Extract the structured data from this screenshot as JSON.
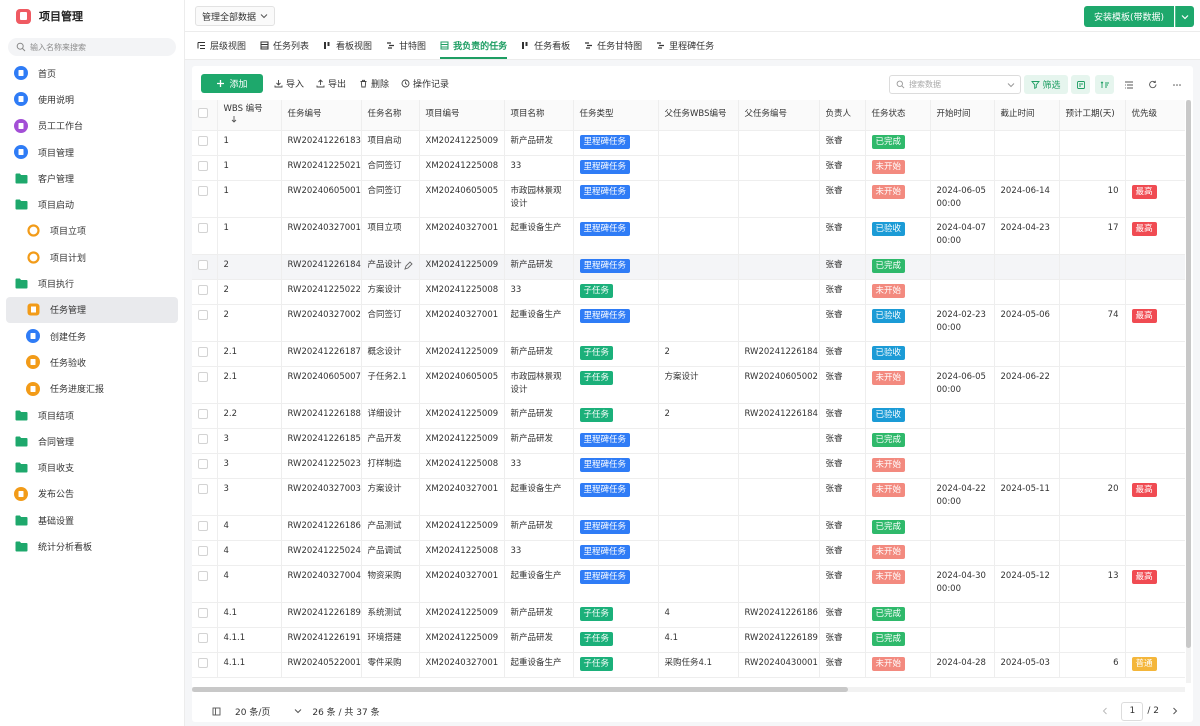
{
  "app": {
    "title": "项目管理"
  },
  "sidebar": {
    "search_placeholder": "输入名称来搜索",
    "items": [
      {
        "label": "首页",
        "icon": "home-icon",
        "type": "circle",
        "color": "#2f7cf6"
      },
      {
        "label": "使用说明",
        "icon": "doc-icon",
        "type": "circle",
        "color": "#2f7cf6"
      },
      {
        "label": "员工工作台",
        "icon": "user-icon",
        "type": "circle",
        "color": "#a34fd6"
      },
      {
        "label": "项目管理",
        "icon": "doc-icon",
        "type": "circle",
        "color": "#2f7cf6"
      },
      {
        "label": "客户管理",
        "icon": "folder-icon",
        "type": "folder",
        "color": "#1ea86c"
      },
      {
        "label": "项目启动",
        "icon": "folder-icon",
        "type": "folder",
        "color": "#1ea86c"
      },
      {
        "label": "项目立项",
        "icon": "circle-o-icon",
        "type": "ring",
        "color": "#f29b18",
        "sub": true
      },
      {
        "label": "项目计划",
        "icon": "circle-o-icon",
        "type": "ring",
        "color": "#f29b18",
        "sub": true
      },
      {
        "label": "项目执行",
        "icon": "folder-icon",
        "type": "folder",
        "color": "#1ea86c"
      },
      {
        "label": "任务管理",
        "icon": "task-icon",
        "type": "square",
        "color": "#f29b18",
        "sub": true,
        "active": true
      },
      {
        "label": "创建任务",
        "icon": "send-icon",
        "type": "circle",
        "color": "#2f7cf6",
        "sub": true
      },
      {
        "label": "任务验收",
        "icon": "shield-icon",
        "type": "circle",
        "color": "#f29b18",
        "sub": true
      },
      {
        "label": "任务进度汇报",
        "icon": "shield-icon",
        "type": "circle",
        "color": "#f29b18",
        "sub": true
      },
      {
        "label": "项目结项",
        "icon": "folder-icon",
        "type": "folder",
        "color": "#1ea86c"
      },
      {
        "label": "合同管理",
        "icon": "folder-icon",
        "type": "folder",
        "color": "#1ea86c"
      },
      {
        "label": "项目收支",
        "icon": "folder-icon",
        "type": "folder",
        "color": "#1ea86c"
      },
      {
        "label": "发布公告",
        "icon": "announce-icon",
        "type": "circle",
        "color": "#f29b18"
      },
      {
        "label": "基础设置",
        "icon": "folder-icon",
        "type": "folder",
        "color": "#1ea86c"
      },
      {
        "label": "统计分析看板",
        "icon": "folder-icon",
        "type": "folder",
        "color": "#1ea86c"
      }
    ]
  },
  "topbar": {
    "scope": "管理全部数据",
    "install_label": "安装模板(带数据)"
  },
  "tabs": [
    {
      "label": "层级视图",
      "icon": "hierarchy-icon"
    },
    {
      "label": "任务列表",
      "icon": "table-icon"
    },
    {
      "label": "看板视图",
      "icon": "kanban-icon"
    },
    {
      "label": "甘特图",
      "icon": "gantt-icon"
    },
    {
      "label": "我负责的任务",
      "icon": "table-icon",
      "active": true
    },
    {
      "label": "任务看板",
      "icon": "kanban-icon"
    },
    {
      "label": "任务甘特图",
      "icon": "gantt-icon"
    },
    {
      "label": "里程碑任务",
      "icon": "gantt-icon"
    }
  ],
  "toolbar": {
    "add": "添加",
    "import": "导入",
    "export": "导出",
    "delete": "删除",
    "log": "操作记录",
    "search_placeholder": "搜索数据",
    "filter": "筛选"
  },
  "colors": {
    "green": "#1ea86c",
    "tag_milestone": "#2f7cf6",
    "tag_subtask": "#1bb07a",
    "status_done": "#2fb96b",
    "status_notstarted": "#f38a7f",
    "status_accepted": "#1b9bd6",
    "pri_high": "#f04b52",
    "pri_normal": "#f4b63a"
  },
  "table": {
    "columns": [
      "WBS 编号",
      "任务编号",
      "任务名称",
      "项目编号",
      "项目名称",
      "任务类型",
      "父任务WBS编号",
      "父任务编号",
      "负责人",
      "任务状态",
      "开始时间",
      "截止时间",
      "预计工期(天)",
      "优先级"
    ],
    "rows": [
      {
        "wbs": "1",
        "task_no": "RW20241226183",
        "task_name": "项目启动",
        "proj_no": "XM20241225009",
        "proj_name": "新产品研发",
        "type": "里程碑任务",
        "parent_wbs": "",
        "parent_no": "",
        "owner": "张睿",
        "status": "已完成",
        "start": "",
        "end": "",
        "dur": "",
        "priority": ""
      },
      {
        "wbs": "1",
        "task_no": "RW20241225021",
        "task_name": "合同签订",
        "proj_no": "XM20241225008",
        "proj_name": "33",
        "type": "里程碑任务",
        "parent_wbs": "",
        "parent_no": "",
        "owner": "张睿",
        "status": "未开始",
        "start": "",
        "end": "",
        "dur": "",
        "priority": ""
      },
      {
        "wbs": "1",
        "task_no": "RW20240605001",
        "task_name": "合同签订",
        "proj_no": "XM20240605005",
        "proj_name": "市政园林景观设计",
        "type": "里程碑任务",
        "parent_wbs": "",
        "parent_no": "",
        "owner": "张睿",
        "status": "未开始",
        "start": "2024-06-05 00:00",
        "end": "2024-06-14",
        "dur": "10",
        "priority": "最高"
      },
      {
        "wbs": "1",
        "task_no": "RW20240327001",
        "task_name": "项目立项",
        "proj_no": "XM20240327001",
        "proj_name": "起重设备生产",
        "type": "里程碑任务",
        "parent_wbs": "",
        "parent_no": "",
        "owner": "张睿",
        "status": "已验收",
        "start": "2024-04-07 00:00",
        "end": "2024-04-23",
        "dur": "17",
        "priority": "最高"
      },
      {
        "wbs": "2",
        "task_no": "RW20241226184",
        "task_name": "产品设计",
        "proj_no": "XM20241225009",
        "proj_name": "新产品研发",
        "type": "里程碑任务",
        "parent_wbs": "",
        "parent_no": "",
        "owner": "张睿",
        "status": "已完成",
        "start": "",
        "end": "",
        "dur": "",
        "priority": "",
        "highlight": true
      },
      {
        "wbs": "2",
        "task_no": "RW20241225022",
        "task_name": "方案设计",
        "proj_no": "XM20241225008",
        "proj_name": "33",
        "type": "子任务",
        "parent_wbs": "",
        "parent_no": "",
        "owner": "张睿",
        "status": "未开始",
        "start": "",
        "end": "",
        "dur": "",
        "priority": ""
      },
      {
        "wbs": "2",
        "task_no": "RW20240327002",
        "task_name": "合同签订",
        "proj_no": "XM20240327001",
        "proj_name": "起重设备生产",
        "type": "里程碑任务",
        "parent_wbs": "",
        "parent_no": "",
        "owner": "张睿",
        "status": "已验收",
        "start": "2024-02-23 00:00",
        "end": "2024-05-06",
        "dur": "74",
        "priority": "最高"
      },
      {
        "wbs": "2.1",
        "task_no": "RW20241226187",
        "task_name": "概念设计",
        "proj_no": "XM20241225009",
        "proj_name": "新产品研发",
        "type": "子任务",
        "parent_wbs": "2",
        "parent_no": "RW20241226184",
        "owner": "张睿",
        "status": "已验收",
        "start": "",
        "end": "",
        "dur": "",
        "priority": ""
      },
      {
        "wbs": "2.1",
        "task_no": "RW20240605007",
        "task_name": "子任务2.1",
        "proj_no": "XM20240605005",
        "proj_name": "市政园林景观设计",
        "type": "子任务",
        "parent_wbs": "方案设计",
        "parent_no": "RW20240605002",
        "owner": "张睿",
        "status": "未开始",
        "start": "2024-06-05 00:00",
        "end": "2024-06-22",
        "dur": "",
        "priority": ""
      },
      {
        "wbs": "2.2",
        "task_no": "RW20241226188",
        "task_name": "详细设计",
        "proj_no": "XM20241225009",
        "proj_name": "新产品研发",
        "type": "子任务",
        "parent_wbs": "2",
        "parent_no": "RW20241226184",
        "owner": "张睿",
        "status": "已验收",
        "start": "",
        "end": "",
        "dur": "",
        "priority": ""
      },
      {
        "wbs": "3",
        "task_no": "RW20241226185",
        "task_name": "产品开发",
        "proj_no": "XM20241225009",
        "proj_name": "新产品研发",
        "type": "里程碑任务",
        "parent_wbs": "",
        "parent_no": "",
        "owner": "张睿",
        "status": "已完成",
        "start": "",
        "end": "",
        "dur": "",
        "priority": ""
      },
      {
        "wbs": "3",
        "task_no": "RW20241225023",
        "task_name": "打样制造",
        "proj_no": "XM20241225008",
        "proj_name": "33",
        "type": "里程碑任务",
        "parent_wbs": "",
        "parent_no": "",
        "owner": "张睿",
        "status": "未开始",
        "start": "",
        "end": "",
        "dur": "",
        "priority": ""
      },
      {
        "wbs": "3",
        "task_no": "RW20240327003",
        "task_name": "方案设计",
        "proj_no": "XM20240327001",
        "proj_name": "起重设备生产",
        "type": "里程碑任务",
        "parent_wbs": "",
        "parent_no": "",
        "owner": "张睿",
        "status": "未开始",
        "start": "2024-04-22 00:00",
        "end": "2024-05-11",
        "dur": "20",
        "priority": "最高"
      },
      {
        "wbs": "4",
        "task_no": "RW20241226186",
        "task_name": "产品测试",
        "proj_no": "XM20241225009",
        "proj_name": "新产品研发",
        "type": "里程碑任务",
        "parent_wbs": "",
        "parent_no": "",
        "owner": "张睿",
        "status": "已完成",
        "start": "",
        "end": "",
        "dur": "",
        "priority": ""
      },
      {
        "wbs": "4",
        "task_no": "RW20241225024",
        "task_name": "产品调试",
        "proj_no": "XM20241225008",
        "proj_name": "33",
        "type": "里程碑任务",
        "parent_wbs": "",
        "parent_no": "",
        "owner": "张睿",
        "status": "未开始",
        "start": "",
        "end": "",
        "dur": "",
        "priority": ""
      },
      {
        "wbs": "4",
        "task_no": "RW20240327004",
        "task_name": "物资采购",
        "proj_no": "XM20240327001",
        "proj_name": "起重设备生产",
        "type": "里程碑任务",
        "parent_wbs": "",
        "parent_no": "",
        "owner": "张睿",
        "status": "未开始",
        "start": "2024-04-30 00:00",
        "end": "2024-05-12",
        "dur": "13",
        "priority": "最高"
      },
      {
        "wbs": "4.1",
        "task_no": "RW20241226189",
        "task_name": "系统测试",
        "proj_no": "XM20241225009",
        "proj_name": "新产品研发",
        "type": "子任务",
        "parent_wbs": "4",
        "parent_no": "RW20241226186",
        "owner": "张睿",
        "status": "已完成",
        "start": "",
        "end": "",
        "dur": "",
        "priority": ""
      },
      {
        "wbs": "4.1.1",
        "task_no": "RW20241226191",
        "task_name": "环境搭建",
        "proj_no": "XM20241225009",
        "proj_name": "新产品研发",
        "type": "子任务",
        "parent_wbs": "4.1",
        "parent_no": "RW20241226189",
        "owner": "张睿",
        "status": "已完成",
        "start": "",
        "end": "",
        "dur": "",
        "priority": ""
      },
      {
        "wbs": "4.1.1",
        "task_no": "RW20240522001",
        "task_name": "零件采购",
        "proj_no": "XM20240327001",
        "proj_name": "起重设备生产",
        "type": "子任务",
        "parent_wbs": "采购任务4.1",
        "parent_no": "RW20240430001",
        "owner": "张睿",
        "status": "未开始",
        "start": "2024-04-28",
        "end": "2024-05-03",
        "dur": "6",
        "priority": "普通"
      }
    ]
  },
  "footer": {
    "page_size": "20 条/页",
    "summary": "26 条 / 共 37 条",
    "page": "1",
    "total_pages": "/ 2"
  }
}
